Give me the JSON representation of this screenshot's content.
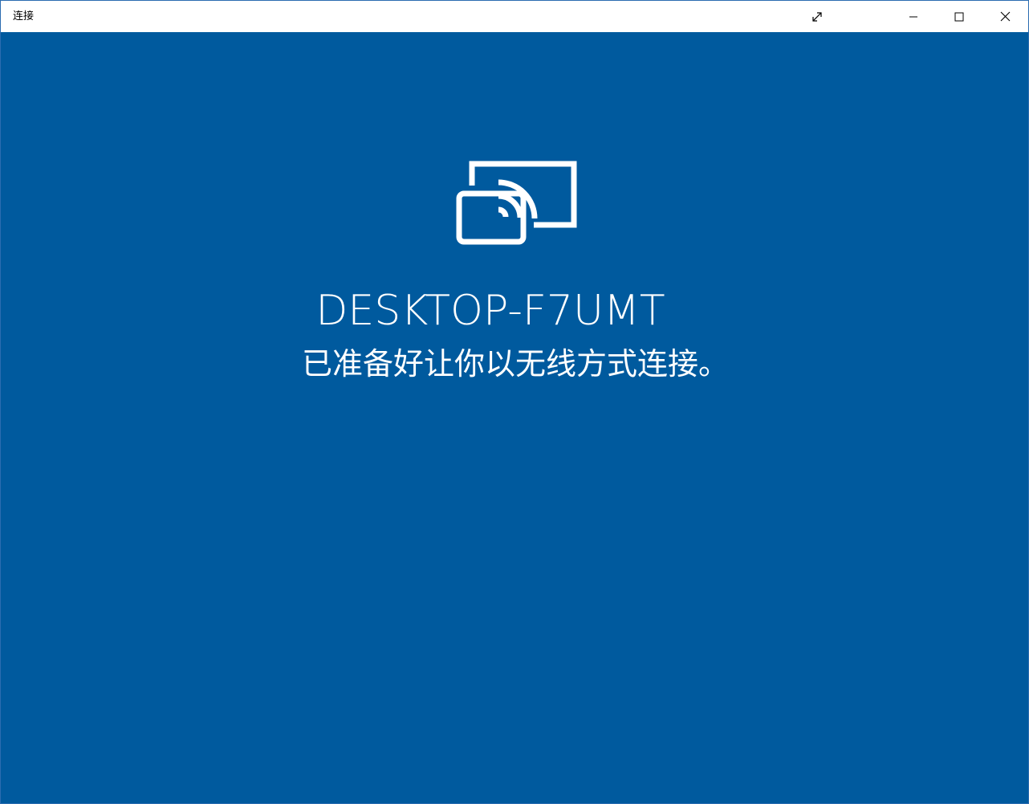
{
  "window": {
    "title": "连接",
    "background_color": "#005a9e",
    "titlebar_color": "#ffffff"
  },
  "titlebar_buttons": {
    "expand_icon": "expand-diagonal-arrows-icon",
    "minimize_icon": "minimize-icon",
    "maximize_icon": "maximize-square-icon",
    "close_icon": "close-x-icon"
  },
  "main": {
    "icon": "wireless-display-cast-icon",
    "device_name": "DESKTOP-F7UMT",
    "status": "已准备好让你以无线方式连接。"
  }
}
